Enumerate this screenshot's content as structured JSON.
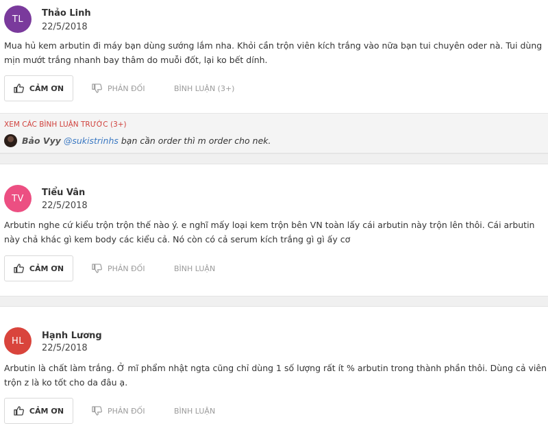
{
  "comments": [
    {
      "initials": "TL",
      "avatar_color": "#7a3a9c",
      "author": "Thảo Linh",
      "date": "22/5/2018",
      "text": "Mua hủ kem arbutin đi máy bạn dùng sướng lắm nha. Khỏi cần trộn viên kích trắng vào nữa bạn tui chuyên oder nà. Tui dùng mịn mướt trắng nhanh bay thâm do muỗi đốt, lại ko bết dính.",
      "thanks_label": "CẢM ƠN",
      "disagree_label": "PHẢN ĐỐI",
      "comment_label": "BÌNH LUẬN (3+)"
    },
    {
      "initials": "TV",
      "avatar_color": "#ec4f82",
      "author": "Tiểu Vân",
      "date": "22/5/2018",
      "text": "Arbutin nghe cứ kiểu trộn trộn thế nào ý. e nghĩ mấy loại kem trộn bên VN toàn lấy cái arbutin này trộn lên thôi. Cái arbutin này chả khác gì kem body các kiểu cả. Nó còn có cả serum kích trắng gì gì ấy cơ",
      "thanks_label": "CẢM ƠN",
      "disagree_label": "PHẢN ĐỐI",
      "comment_label": "BÌNH LUẬN"
    },
    {
      "initials": "HL",
      "avatar_color": "#d9443c",
      "author": "Hạnh Lương",
      "date": "22/5/2018",
      "text": "Arbutin là chất làm trắng. Ở mĩ phẩm nhật ngta cũng chỉ dùng 1 số lượng rất ít % arbutin trong thành phần thôi. Dùng cả viên trộn z là ko tốt cho da đâu ạ.",
      "thanks_label": "CẢM ƠN",
      "disagree_label": "PHẢN ĐỐI",
      "comment_label": "BÌNH LUẬN"
    }
  ],
  "replies": {
    "more_label": "XEM CÁC BÌNH LUẬN TRƯỚC (3+)",
    "user": "Bảo Vyy",
    "mention": "@sukistrinhs",
    "text": " bạn cần order thì m order cho nek."
  },
  "icons": {
    "thanks": "thumbs-up-icon",
    "disagree": "thumbs-down-icon"
  }
}
